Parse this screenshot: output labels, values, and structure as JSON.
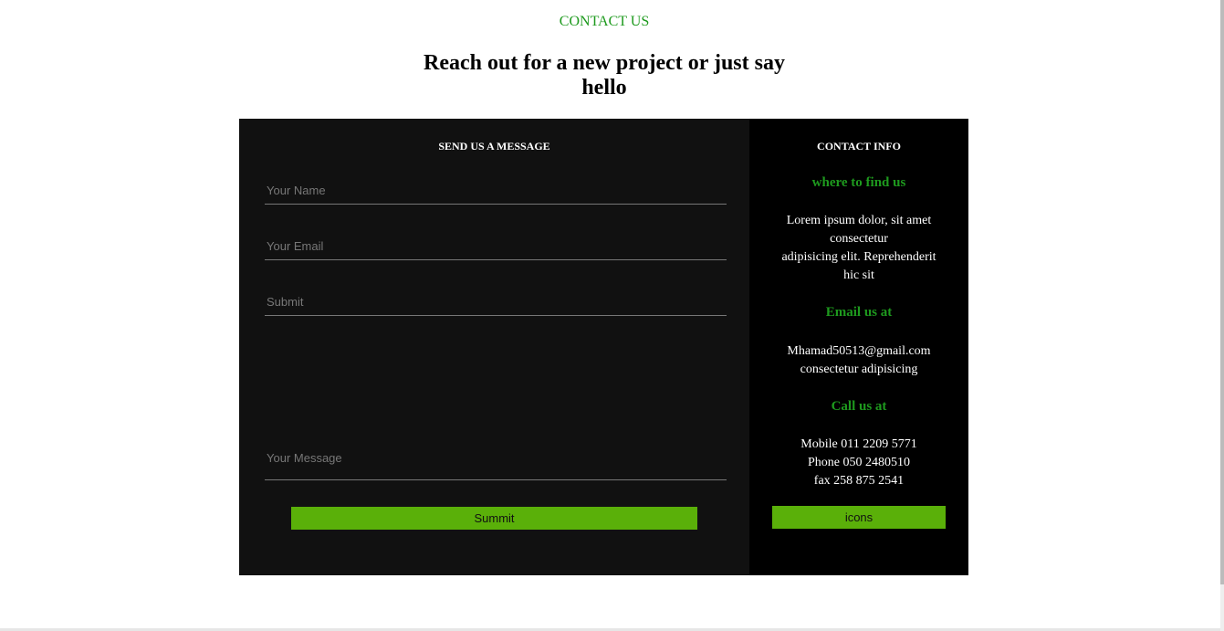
{
  "header": {
    "eyebrow": "CONTACT US",
    "title": "Reach out for a new project or just say hello"
  },
  "form": {
    "heading": "SEND US A MESSAGE",
    "name_placeholder": "Your Name",
    "email_placeholder": "Your Email",
    "subject_placeholder": "Submit",
    "message_placeholder": "Your Message",
    "submit_label": "Summit"
  },
  "info": {
    "heading": "CONTACT INFO",
    "find_label": "where to find us",
    "address_line1": "Lorem ipsum dolor, sit amet consectetur",
    "address_line2": "adipisicing elit. Reprehenderit hic sit",
    "email_label": "Email us at",
    "email": "Mhamad50513@gmail.com",
    "email_note": "consectetur adipisicing",
    "call_label": "Call us at",
    "mobile": "Mobile 011 2209 5771",
    "phone": "Phone 050 2480510",
    "fax": "fax 258 875 2541",
    "icons_label": "icons"
  },
  "colors": {
    "accent": "#1e9a1e",
    "button": "#5ab009"
  }
}
